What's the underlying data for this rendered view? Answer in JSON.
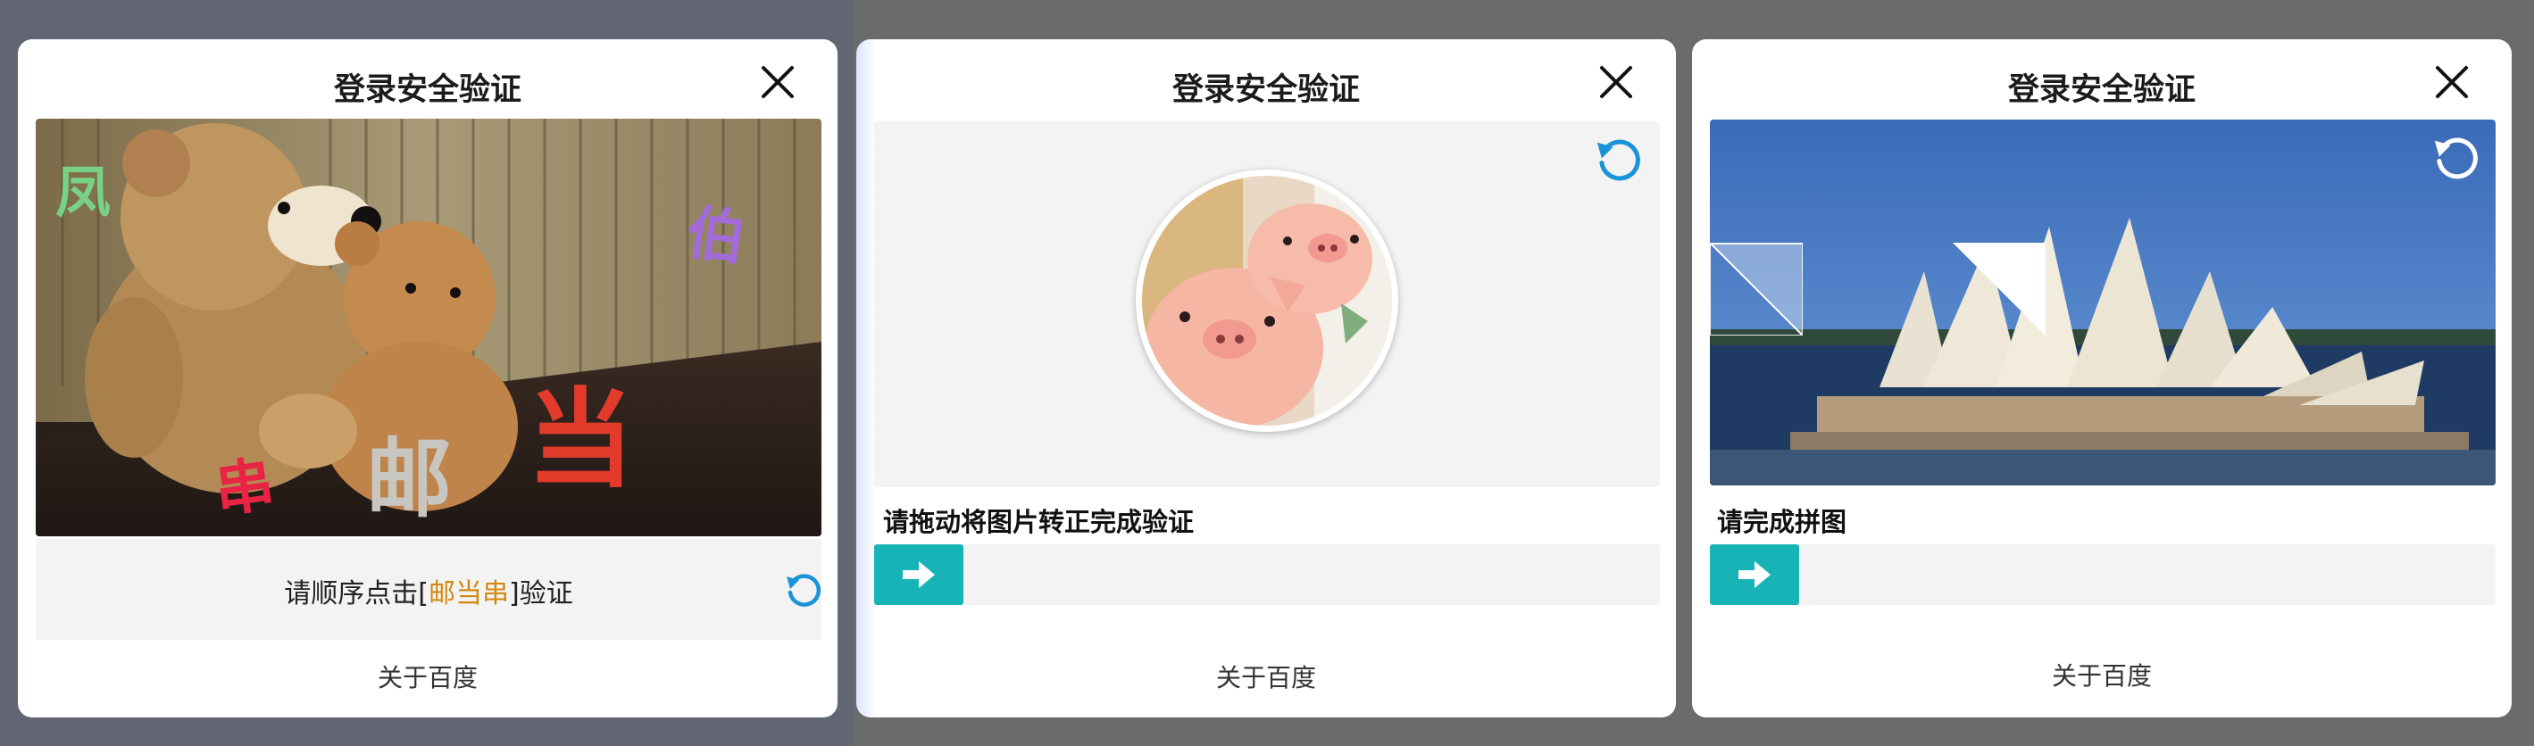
{
  "panels": [
    {
      "title": "登录安全验证",
      "instruction_prefix": "请顺序点击[",
      "instruction_chars": "邮当串",
      "instruction_suffix": "]验证",
      "chars": [
        "凤",
        "伯",
        "当",
        "串",
        "邮"
      ],
      "footer": "关于百度"
    },
    {
      "title": "登录安全验证",
      "instruction": "请拖动将图片转正完成验证",
      "footer": "关于百度"
    },
    {
      "title": "登录安全验证",
      "instruction": "请完成拼图",
      "footer": "关于百度"
    }
  ],
  "colors": {
    "accent_teal": "#17b3b6",
    "refresh_blue": "#1a94d8",
    "highlight_orange": "#d08a12"
  },
  "icons": [
    "close-icon",
    "refresh-icon",
    "arrow-right-icon"
  ]
}
